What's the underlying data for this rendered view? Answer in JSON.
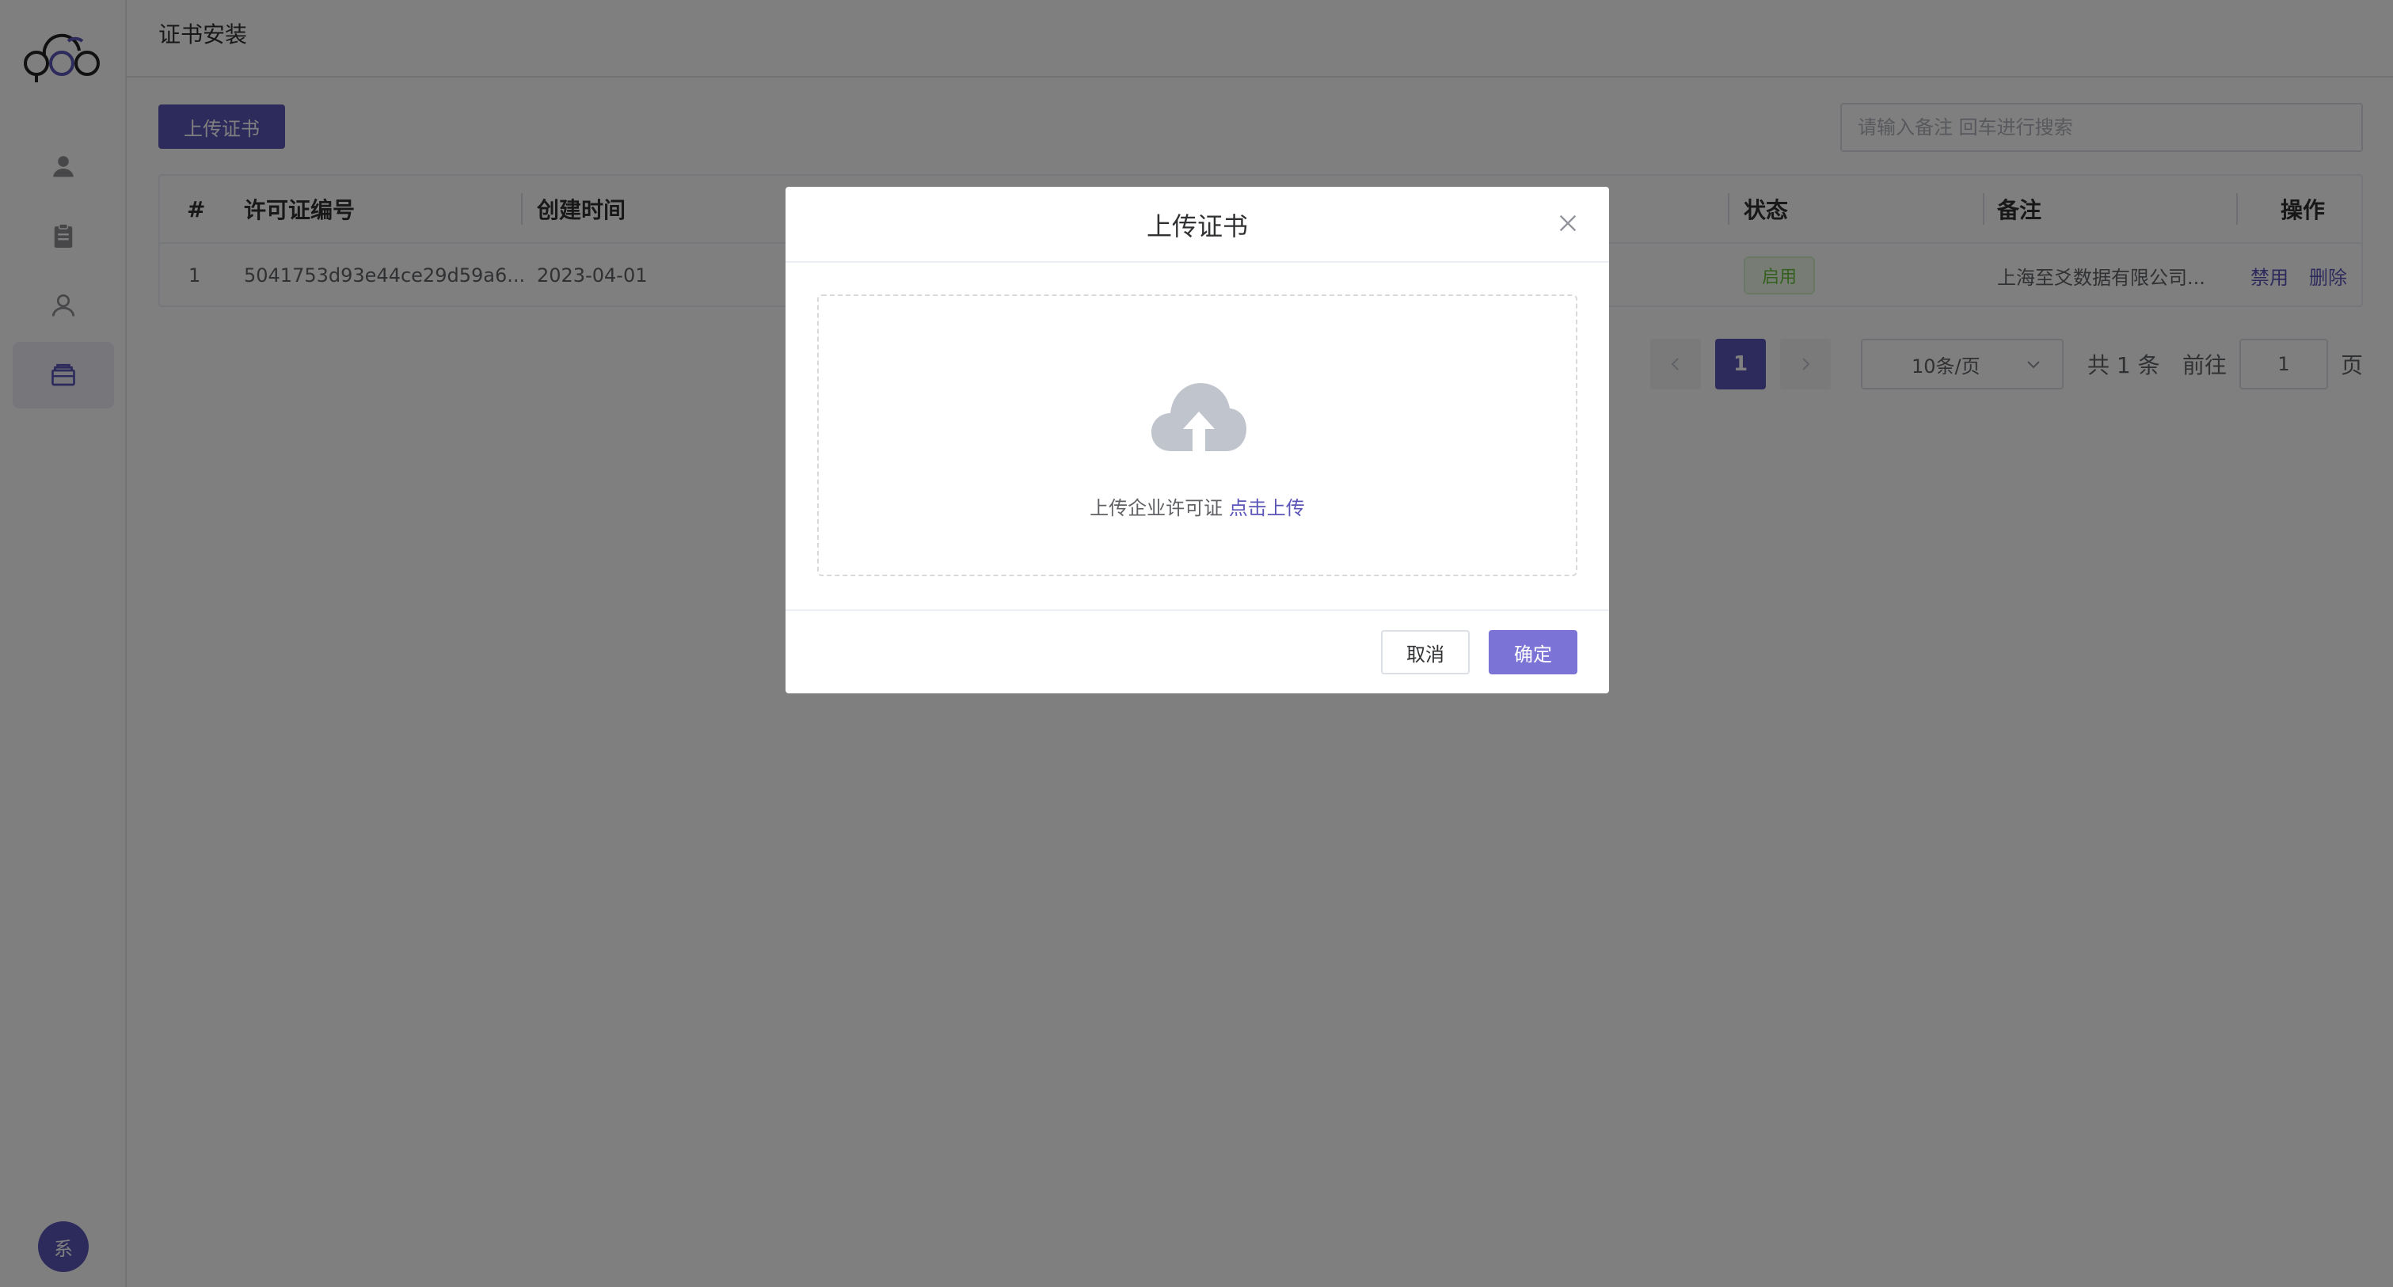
{
  "page": {
    "title": "证书安装"
  },
  "sidebar": {
    "logo_icon": "cloud-logo-icon",
    "items": [
      {
        "icon": "user-filled-icon"
      },
      {
        "icon": "clipboard-icon"
      },
      {
        "icon": "user-outline-icon"
      },
      {
        "icon": "certificate-box-icon",
        "active": true
      }
    ],
    "avatar_text": "系"
  },
  "toolbar": {
    "upload_label": "上传证书",
    "search_placeholder": "请输入备注 回车进行搜索"
  },
  "table": {
    "headers": {
      "index": "#",
      "license_no": "许可证编号",
      "created": "创建时间",
      "status": "状态",
      "remark": "备注",
      "ops": "操作"
    },
    "rows": [
      {
        "index": "1",
        "license_no": "5041753d93e44ce29d59a6...",
        "created": "2023-04-01",
        "status": "启用",
        "remark": "上海至爻数据有限公司...",
        "op_disable": "禁用",
        "op_delete": "删除"
      }
    ]
  },
  "pagination": {
    "prev_icon": "chevron-left-icon",
    "next_icon": "chevron-right-icon",
    "current_page": "1",
    "page_size": "10条/页",
    "total_text": "共 1 条",
    "goto_label": "前往",
    "goto_value": "1",
    "page_suffix": "页"
  },
  "dialog": {
    "title": "上传证书",
    "close_icon": "close-icon",
    "upload_icon": "cloud-upload-icon",
    "upload_hint": "上传企业许可证",
    "upload_link": "点击上传",
    "cancel_label": "取消",
    "confirm_label": "确定"
  },
  "colors": {
    "primary": "#5b55b8",
    "primary_light": "#7b74d6",
    "success": "#67c23a",
    "overlay": "rgba(0,0,0,0.5)"
  }
}
